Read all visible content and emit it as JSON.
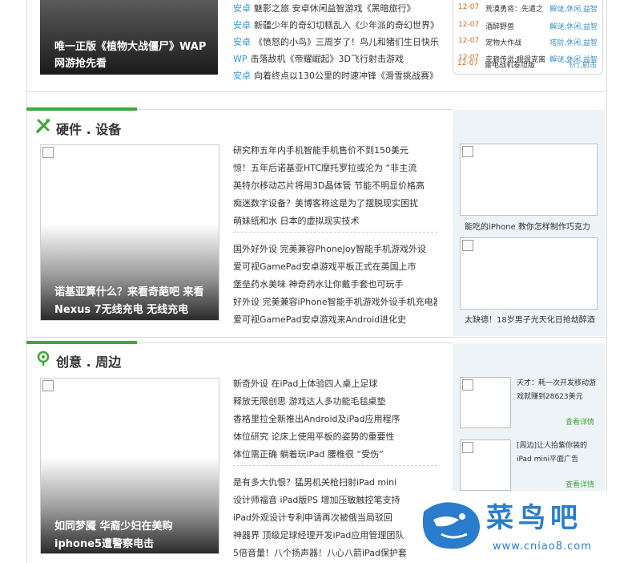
{
  "top": {
    "featured_caption": "唯一正版《植物大战僵尸》WAP网游抢先看",
    "news": [
      {
        "cat": "安卓",
        "text": "魅影之旅 安卓休闲益智游戏《黑暗旅行》"
      },
      {
        "cat": "安卓",
        "text": "新疆少年的奇幻切糕乱入《少年派的奇幻世界》"
      },
      {
        "cat": "安卓",
        "text": "《愤怒的小鸟》三周岁了！鸟儿和猪们生日快乐"
      },
      {
        "cat": "WP",
        "text": "击落敌机《帝耀崛起》3D飞行射击游戏"
      },
      {
        "cat": "安卓",
        "text": "向着终点以130公里的时速冲锋《滑雪挑战赛》"
      }
    ],
    "schedule": [
      {
        "date": "12-07",
        "name": "荒漠勇将：先遣之",
        "genre": "解谜,休闲,益智"
      },
      {
        "date": "12-07",
        "name": "酒醉野兽",
        "genre": "解谜,休闲,益智"
      },
      {
        "date": "12-07",
        "name": "宠物大作战",
        "genre": "塔防,休闲,益智"
      },
      {
        "date": "12-07",
        "name": "克赖传说:眼很克离",
        "genre": "解谜,休闲,益智"
      },
      {
        "date": "12-07",
        "name": "雷电战机泰坦版",
        "genre": "飞行,射击"
      }
    ]
  },
  "hardware": {
    "title": "硬件 . 设备",
    "main_caption": "诺基亚算什么？来看奇葩吧 来看 Nexus 7无线充电 无线充电",
    "news_a": [
      "研究称五年内手机智能手机售价不到150美元",
      "惊！五年后诺基亚HTC摩托罗拉或沦为 “非主流",
      "英特尔移动芯片将用3D晶体管 节能不明显价格高",
      "痴迷数字设备？美博客称这是为了摆脱现实困扰",
      "萌妹纸和水 日本的虚拟现实技术"
    ],
    "news_b": [
      "国外好外设 完美兼容PhoneJoy智能手机游戏外设",
      "爱可视GamePad安卓游戏平板正式在英国上市",
      "堡垒药水美味 神奇药水让你戴手套也可玩手",
      "好外设 完美兼容iPhone智能手机游戏外设手机充电器",
      "爱可视GamePad安卓游戏来Android进化史"
    ],
    "side": [
      {
        "caption": "能吃的iPhone 教你怎样制作巧克力"
      },
      {
        "caption": "太缺德！18岁男子光天化日抢劫醉酒"
      }
    ]
  },
  "creative": {
    "title": "创意 . 周边",
    "main_caption": "如同梦魇 华裔少妇在美购iphone5遭警察电击",
    "news_a": [
      "新奇外设 在iPad上体验四人桌上足球",
      "释放无限创思 游戏达人多功能毛毯桌垫",
      "香格里拉全新推出Android及iPad应用程序",
      "体位研究 论床上使用平板的姿势的重要性",
      "体位需正确 躺着玩iPad 腰椎很 “受伤”"
    ],
    "news_b": [
      "是有多大仇恨？猛男机关枪扫射iPad mini",
      "设计师福音 iPad版PS 增加压敏触控笔支持",
      "iPad外观设计专利申请再次被俄当局驳回",
      "神器界 顶级足球经理开发iPad应用管理团队",
      "5倍音量！八个扬声器！八心八箭iPad保护套"
    ],
    "side": [
      {
        "text": "天才：耗一次开发移动游戏就赚到28623美元",
        "detail": "查看详情"
      },
      {
        "text": "[周边]让人抬紫你装的iPad mini平面广告",
        "detail": "查看详情"
      }
    ]
  },
  "logo": {
    "name": "菜鸟吧",
    "url": "www.cniao8.com"
  },
  "colors": {
    "accent_green": "#3ea739",
    "link_blue": "#2f9bd8",
    "date_orange": "#d06a1c",
    "panel_bg": "#edf3f6"
  }
}
